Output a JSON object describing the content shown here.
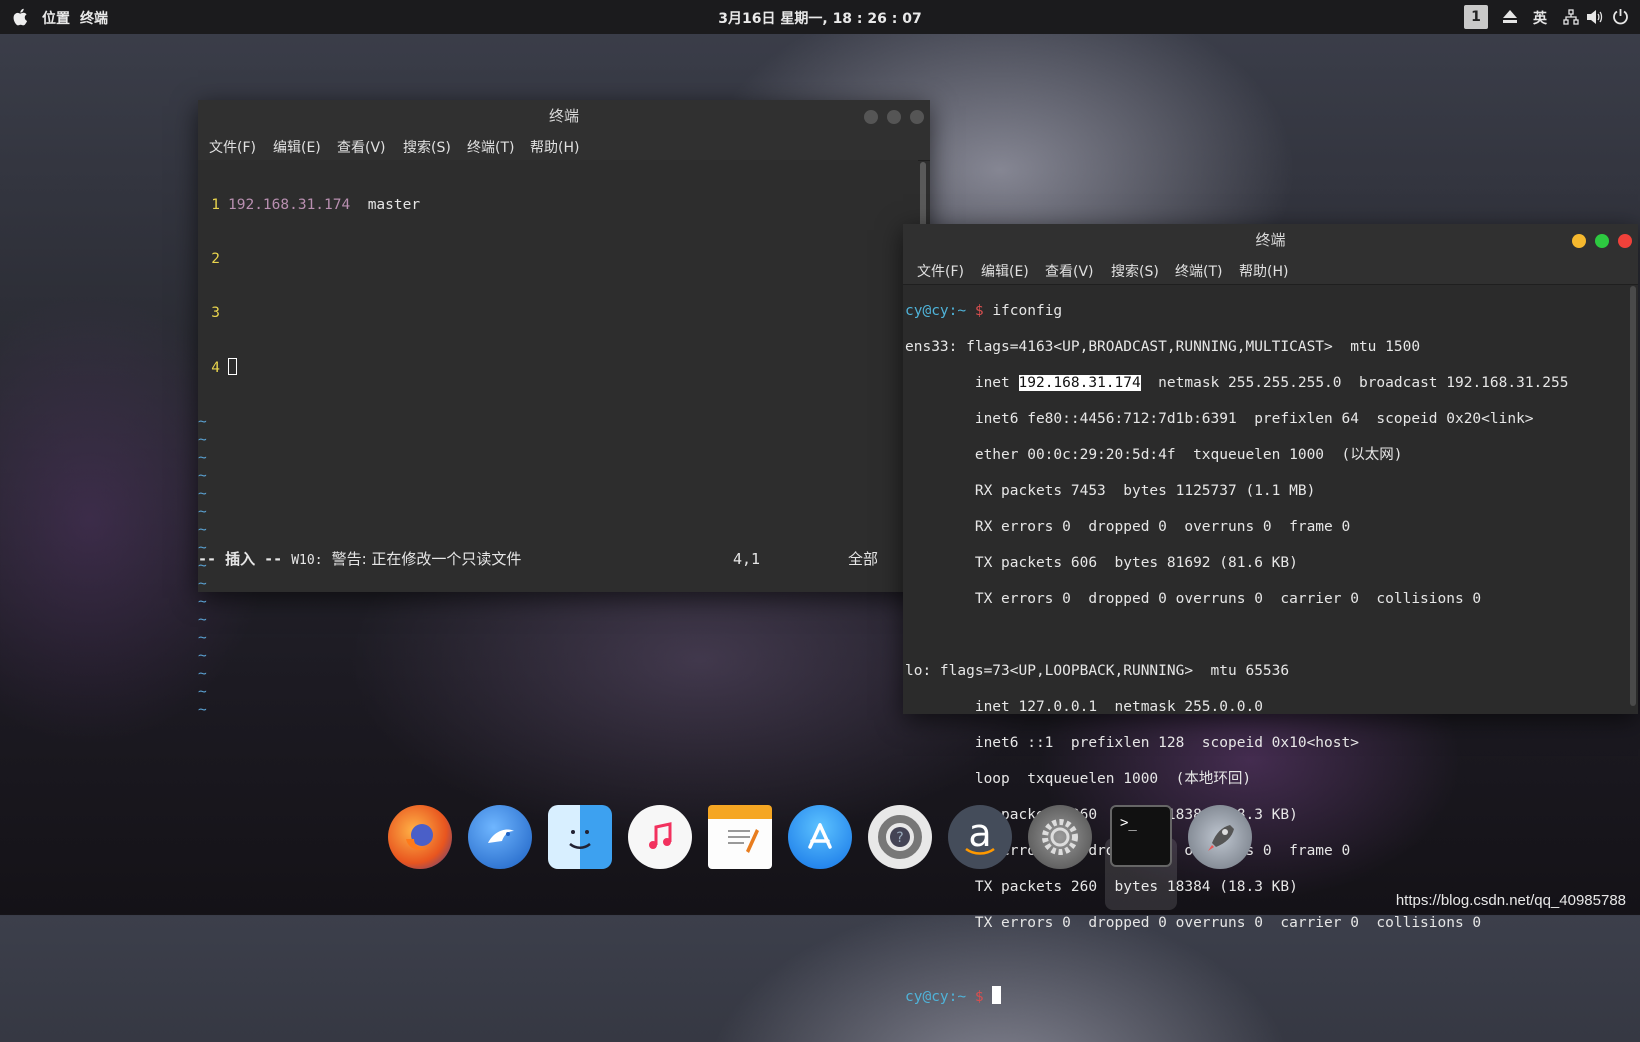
{
  "topbar": {
    "places": "位置",
    "terminal": "终端",
    "clock": "3月16日 星期一, 18 : 26 : 07",
    "workspace": "1",
    "input_method": "英",
    "icon_eject": "eject-icon",
    "icon_network": "network-icon",
    "icon_volume": "volume-icon",
    "icon_power": "power-icon"
  },
  "editor_window": {
    "title": "终端",
    "menu": [
      "文件(F)",
      "编辑(E)",
      "查看(V)",
      "搜索(S)",
      "终端(T)",
      "帮助(H)"
    ],
    "lines": [
      {
        "num": "1",
        "ip": "192.168.31.174",
        "host": "master"
      },
      {
        "num": "2"
      },
      {
        "num": "3"
      },
      {
        "num": "4"
      }
    ],
    "tilde": "~",
    "status": {
      "mode": "-- 插入 --",
      "warning_code": "W10:",
      "warning_text": "警告: 正在修改一个只读文件",
      "position": "4,1",
      "scroll": "全部"
    }
  },
  "shell_window": {
    "title": "终端",
    "menu": [
      "文件(F)",
      "编辑(E)",
      "查看(V)",
      "搜索(S)",
      "终端(T)",
      "帮助(H)"
    ],
    "prompt_user": "cy@cy:~",
    "prompt_symbol": "$",
    "command": "ifconfig",
    "ens33_header": "ens33: flags=4163<UP,BROADCAST,RUNNING,MULTICAST>  mtu 1500",
    "ens33_inet_label": "        inet ",
    "ens33_inet_ip": "192.168.31.174",
    "ens33_inet_rest": "  netmask 255.255.255.0  broadcast 192.168.31.255",
    "ens33_lines": [
      "        inet6 fe80::4456:712:7d1b:6391  prefixlen 64  scopeid 0x20<link>",
      "        ether 00:0c:29:20:5d:4f  txqueuelen 1000  (以太网)",
      "        RX packets 7453  bytes 1125737 (1.1 MB)",
      "        RX errors 0  dropped 0  overruns 0  frame 0",
      "        TX packets 606  bytes 81692 (81.6 KB)",
      "        TX errors 0  dropped 0 overruns 0  carrier 0  collisions 0"
    ],
    "lo_lines": [
      "lo: flags=73<UP,LOOPBACK,RUNNING>  mtu 65536",
      "        inet 127.0.0.1  netmask 255.0.0.0",
      "        inet6 ::1  prefixlen 128  scopeid 0x10<host>",
      "        loop  txqueuelen 1000  (本地环回)",
      "        RX packets 260  bytes 18384 (18.3 KB)",
      "        RX errors 0  dropped 0  overruns 0  frame 0",
      "        TX packets 260  bytes 18384 (18.3 KB)",
      "        TX errors 0  dropped 0 overruns 0  carrier 0  collisions 0"
    ]
  },
  "dock": [
    {
      "name": "firefox-icon"
    },
    {
      "name": "eagle-browser-icon"
    },
    {
      "name": "finder-icon"
    },
    {
      "name": "music-icon"
    },
    {
      "name": "pages-icon"
    },
    {
      "name": "app-store-icon"
    },
    {
      "name": "help-lifebuoy-icon"
    },
    {
      "name": "amazon-icon",
      "glyph": "a"
    },
    {
      "name": "settings-gear-icon"
    },
    {
      "name": "terminal-icon",
      "glyph": ">_"
    },
    {
      "name": "launchpad-rocket-icon"
    }
  ],
  "watermark": "https://blog.csdn.net/qq_40985788",
  "colors": {
    "prompt_user": "#4fb3d9",
    "prompt_symbol": "#d94f4f",
    "line_number": "#e8d44d",
    "btn_yellow": "#f5b82e",
    "btn_green": "#2dc940",
    "btn_red": "#f0413a"
  }
}
